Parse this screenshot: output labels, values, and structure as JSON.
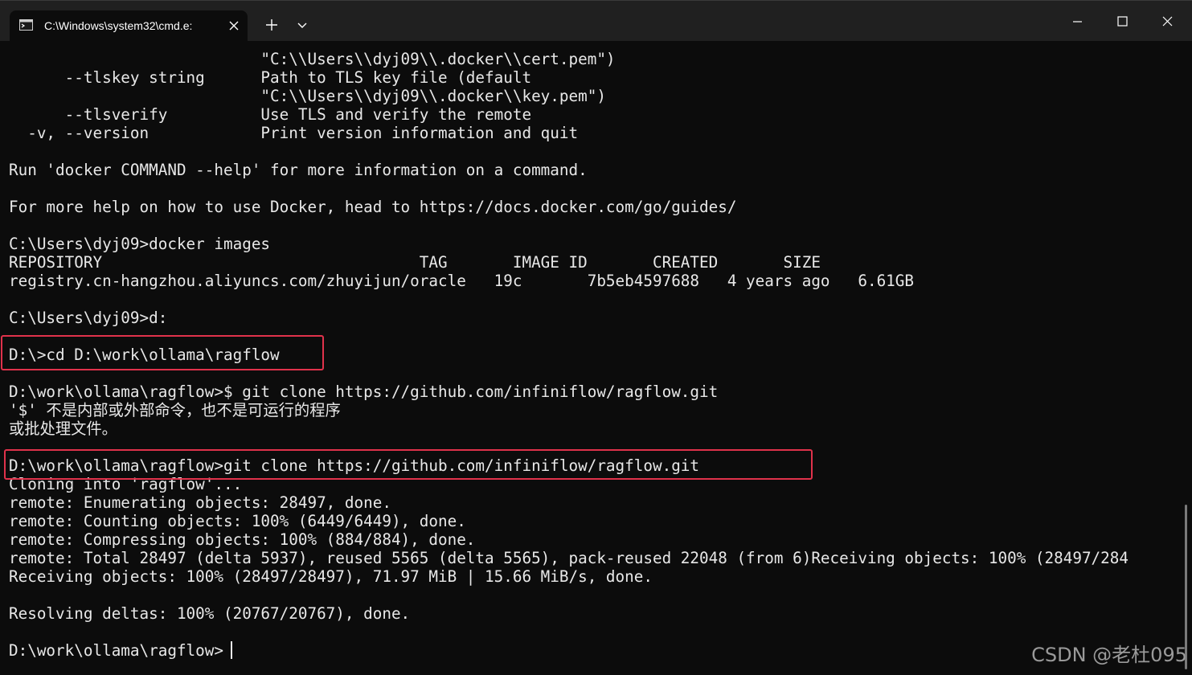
{
  "titlebar": {
    "tab_title": "C:\\Windows\\system32\\cmd.e:",
    "icons": {
      "tab": "terminal-icon",
      "tab_close": "close-icon",
      "new_tab": "plus-icon",
      "dropdown": "chevron-down-icon",
      "minimize": "minimize-icon",
      "maximize": "maximize-icon",
      "close": "close-icon"
    }
  },
  "terminal": {
    "lines": [
      "                           \"C:\\\\Users\\\\dyj09\\\\.docker\\\\cert.pem\")",
      "      --tlskey string      Path to TLS key file (default",
      "                           \"C:\\\\Users\\\\dyj09\\\\.docker\\\\key.pem\")",
      "      --tlsverify          Use TLS and verify the remote",
      "  -v, --version            Print version information and quit",
      "",
      "Run 'docker COMMAND --help' for more information on a command.",
      "",
      "For more help on how to use Docker, head to https://docs.docker.com/go/guides/",
      "",
      "C:\\Users\\dyj09>docker images",
      "REPOSITORY                                  TAG       IMAGE ID       CREATED       SIZE",
      "registry.cn-hangzhou.aliyuncs.com/zhuyijun/oracle   19c       7b5eb4597688   4 years ago   6.61GB",
      "",
      "C:\\Users\\dyj09>d:",
      "",
      "D:\\>cd D:\\work\\ollama\\ragflow",
      "",
      "D:\\work\\ollama\\ragflow>$ git clone https://github.com/infiniflow/ragflow.git",
      "'$' 不是内部或外部命令，也不是可运行的程序",
      "或批处理文件。",
      "",
      "D:\\work\\ollama\\ragflow>git clone https://github.com/infiniflow/ragflow.git",
      "Cloning into 'ragflow'...",
      "remote: Enumerating objects: 28497, done.",
      "remote: Counting objects: 100% (6449/6449), done.",
      "remote: Compressing objects: 100% (884/884), done.",
      "remote: Total 28497 (delta 5937), reused 5565 (delta 5565), pack-reused 22048 (from 6)Receiving objects: 100% (28497/284",
      "Receiving objects: 100% (28497/28497), 71.97 MiB | 15.66 MiB/s, done.",
      "",
      "Resolving deltas: 100% (20767/20767), done.",
      "",
      "D:\\work\\ollama\\ragflow>"
    ]
  },
  "watermark": "CSDN @老杜095",
  "colors": {
    "background": "#0c0c0c",
    "titlebar": "#202020",
    "text": "#e8e8e8",
    "highlight_box": "#e0324b"
  }
}
